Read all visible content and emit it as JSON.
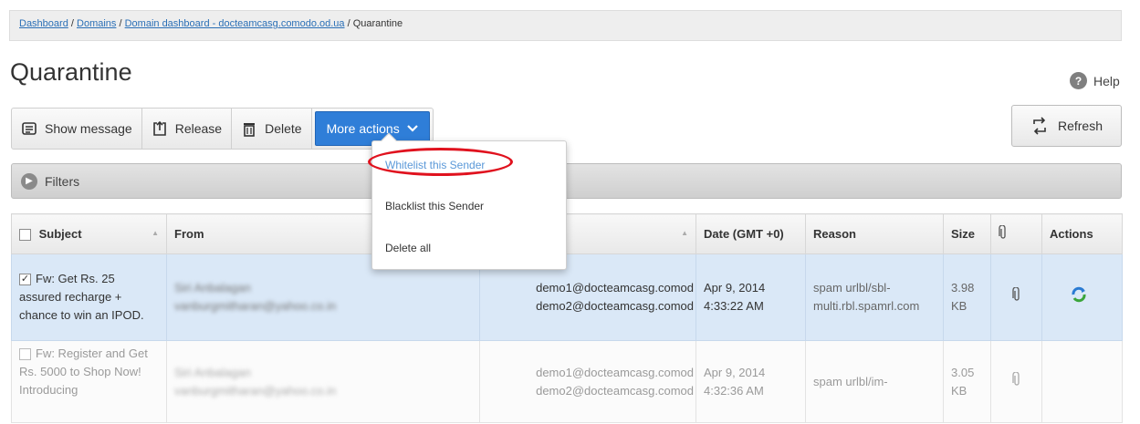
{
  "breadcrumb": {
    "items": [
      "Dashboard",
      "Domains",
      "Domain dashboard - docteamcasg.comodo.od.ua"
    ],
    "current": "Quarantine",
    "separator": "/"
  },
  "page": {
    "title": "Quarantine",
    "help_label": "Help"
  },
  "toolbar": {
    "show_message": "Show message",
    "release": "Release",
    "delete": "Delete",
    "more_actions": "More actions"
  },
  "refresh_label": "Refresh",
  "filters_label": "Filters",
  "more_menu": {
    "items": [
      "Whitelist this Sender",
      "Blacklist this Sender",
      "Delete all"
    ]
  },
  "table": {
    "headers": {
      "subject": "Subject",
      "from": "From",
      "date": "Date (GMT +0)",
      "reason": "Reason",
      "size": "Size",
      "actions": "Actions"
    },
    "rows": [
      {
        "checked": true,
        "subject": "Fw: Get Rs. 25 assured recharge + chance to win an IPOD.",
        "from_name": "Siri Anbalagan",
        "from_email": "vanburgmitharan@yahoo.co.in",
        "to1": "demo1@docteamcasg.comod",
        "to2": "demo2@docteamcasg.comod",
        "date1": "Apr 9, 2014",
        "date2": "4:33:22 AM",
        "reason": "spam urlbl/sbl-multi.rbl.spamrl.com",
        "size": "3.98 KB"
      },
      {
        "checked": false,
        "subject": "Fw: Register and Get Rs. 5000 to Shop Now! Introducing",
        "from_name": "Siri Anbalagan",
        "from_email": "vanburgmitharan@yahoo.co.in",
        "to1": "demo1@docteamcasg.comod",
        "to2": "demo2@docteamcasg.comod",
        "date1": "Apr 9, 2014",
        "date2": "4:32:36 AM",
        "reason": "spam urlbl/im-",
        "size": "3.05 KB"
      }
    ]
  },
  "colors": {
    "accent": "#2f7ed8",
    "selected_row": "#dae8f7",
    "highlight_oval": "#e0121e"
  }
}
